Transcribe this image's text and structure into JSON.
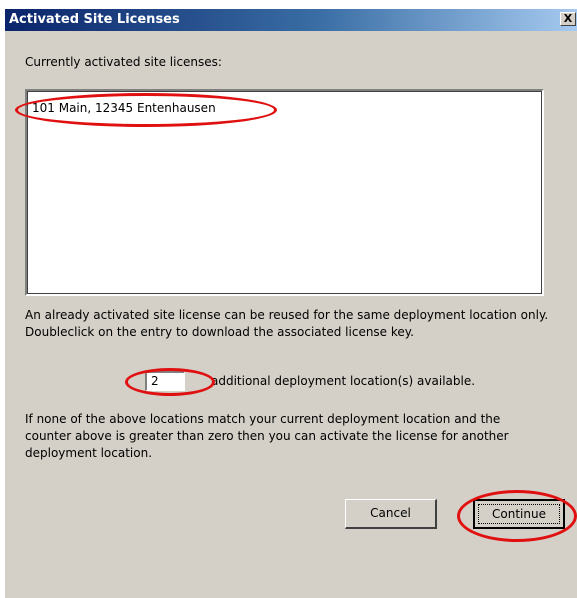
{
  "window": {
    "title": "Activated Site Licenses",
    "close_label": "X"
  },
  "licenses": {
    "heading": "Currently activated site licenses:",
    "items": [
      "101 Main, 12345 Entenhausen"
    ]
  },
  "info_text": "An already activated site license can be reused for the same deployment location only. Doubleclick on the entry to download the associated license key.",
  "counter": {
    "value": "2",
    "suffix": "additional deployment location(s) available."
  },
  "hint_text": "If none of the above locations match your current deployment location and the counter above is greater than zero then you can activate the license for another deployment location.",
  "buttons": {
    "cancel": "Cancel",
    "continue": "Continue"
  },
  "colors": {
    "annotation": "#e01010",
    "titlebar_start": "#0a246a",
    "dialog_bg": "#d4d0c8"
  }
}
